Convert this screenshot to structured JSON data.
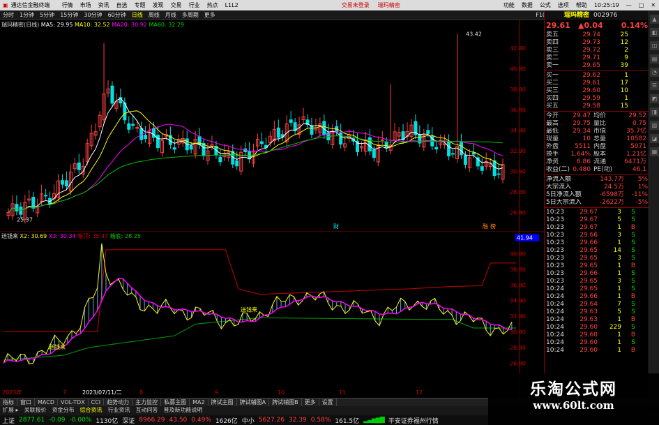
{
  "titlebar": {
    "app": "通达信金融终端",
    "menus": [
      "行情",
      "市场",
      "资讯",
      "自选",
      "专题",
      "发现",
      "交易",
      "行业",
      "热点",
      "L1L2"
    ],
    "center": [
      "交易未登录",
      "瑞玛精密"
    ],
    "right": [
      "功能",
      "数据",
      "公式",
      "选项",
      "帮助"
    ],
    "time": "10:25:19"
  },
  "toolbar": {
    "periods": [
      "分时",
      "1分钟",
      "5分钟",
      "15分钟",
      "30分钟",
      "60分钟",
      "日线",
      "周线",
      "月线",
      "多周期",
      "更多"
    ],
    "right": [
      "F10",
      "标记",
      "☰"
    ]
  },
  "chart_legend": {
    "name": "瑞玛精密(日线)",
    "ma5": "MA5: 29.95",
    "ma10": "MA10: 32.52",
    "ma20": "MA20: 30.92",
    "ma60": "MA60: 32.29"
  },
  "price_chart": {
    "high_label": "43.42",
    "low_label": "25.37",
    "axis": [
      "42.00",
      "40.00",
      "38.00",
      "36.00",
      "34.00",
      "32.00",
      "30.00",
      "28.00",
      "26.00"
    ],
    "markers": [
      "财",
      "融",
      "榜"
    ]
  },
  "indicator_legend": {
    "name": "送钱来",
    "x2": "X2: 30.69",
    "x3": "X3: 30.34",
    "box_top": "箱顶: 35.47",
    "box_bottom": "箱底: 28.25"
  },
  "indicator_chart": {
    "current": "41.94",
    "axis": [
      "40.00",
      "38.00",
      "36.00",
      "34.00",
      "32.00",
      "30.00",
      "28.00",
      "26.00"
    ],
    "label": "送钱来"
  },
  "time_axis": {
    "labels": [
      "2023年",
      "7",
      "2023/07/11/二",
      "8",
      "9",
      "10",
      "11",
      "12",
      "1"
    ]
  },
  "quote_header": {
    "name": "瑞玛精密",
    "code": "002976",
    "price": "29.61",
    "change": "▲0.04",
    "pct": "0.14%"
  },
  "order_book": {
    "asks": [
      {
        "label": "卖五",
        "price": "29.74",
        "vol": "25"
      },
      {
        "label": "卖四",
        "price": "29.73",
        "vol": "12"
      },
      {
        "label": "卖三",
        "price": "29.72",
        "vol": "2"
      },
      {
        "label": "卖二",
        "price": "29.71",
        "vol": "9"
      },
      {
        "label": "卖一",
        "price": "29.65",
        "vol": "39"
      }
    ],
    "bids": [
      {
        "label": "买一",
        "price": "29.62",
        "vol": "1"
      },
      {
        "label": "买二",
        "price": "29.61",
        "vol": "17"
      },
      {
        "label": "买三",
        "price": "29.60",
        "vol": "10"
      },
      {
        "label": "买四",
        "price": "29.59",
        "vol": "1"
      },
      {
        "label": "买五",
        "price": "29.58",
        "vol": "15"
      }
    ]
  },
  "stats": [
    {
      "a": "今开",
      "b": "29.47",
      "c": "均价",
      "d": "29.52"
    },
    {
      "a": "最高",
      "b": "29.75",
      "c": "量比",
      "d": "0.75"
    },
    {
      "a": "最低",
      "b": "29.34",
      "c": "市值",
      "d": "35.7亿"
    },
    {
      "a": "现量",
      "b": "10",
      "c": "总量",
      "d": "10582"
    },
    {
      "a": "外盘",
      "b": "5511",
      "c": "内盘",
      "d": "5071"
    },
    {
      "a": "换手",
      "b": "1.64%",
      "c": "股本",
      "d": "1.21亿"
    },
    {
      "a": "净资",
      "b": "6.86",
      "c": "流通",
      "d": "6471万"
    },
    {
      "a": "收益(二)",
      "b": "0.480",
      "c": "PE(动)",
      "d": "46.1"
    }
  ],
  "flows": [
    {
      "label": "净流入额",
      "value": "143.7万",
      "pct": "5%"
    },
    {
      "label": "大宗流入",
      "value": "24.5万",
      "pct": "1%"
    },
    {
      "label": "5日净流入额",
      "value": "-6598万",
      "pct": "-11%"
    },
    {
      "label": "5日大宗流入",
      "value": "-2622万",
      "pct": "-5%"
    }
  ],
  "ticks": [
    {
      "t": "10:23",
      "p": "29.67",
      "v": "3",
      "s": "S"
    },
    {
      "t": "10:23",
      "p": "29.67",
      "v": "5",
      "s": "S"
    },
    {
      "t": "10:23",
      "p": "29.67",
      "v": "1",
      "s": "B"
    },
    {
      "t": "10:23",
      "p": "29.66",
      "v": "3",
      "s": "S"
    },
    {
      "t": "10:23",
      "p": "29.66",
      "v": "1",
      "s": "S"
    },
    {
      "t": "10:23",
      "p": "29.65",
      "v": "14",
      "s": "S"
    },
    {
      "t": "10:23",
      "p": "29.65",
      "v": "3",
      "s": "S"
    },
    {
      "t": "10:23",
      "p": "29.65",
      "v": "1",
      "s": "B"
    },
    {
      "t": "10:23",
      "p": "29.66",
      "v": "1",
      "s": "S"
    },
    {
      "t": "10:23",
      "p": "29.65",
      "v": "3",
      "s": "S"
    },
    {
      "t": "10:24",
      "p": "29.65",
      "v": "1",
      "s": "S"
    },
    {
      "t": "10:24",
      "p": "29.66",
      "v": "1",
      "s": "B"
    },
    {
      "t": "10:24",
      "p": "29.64",
      "v": "7",
      "s": "S"
    },
    {
      "t": "10:24",
      "p": "29.63",
      "v": "5",
      "s": "S"
    },
    {
      "t": "10:24",
      "p": "29.63",
      "v": "1",
      "s": "B"
    },
    {
      "t": "10:24",
      "p": "29.60",
      "v": "229",
      "s": "S"
    },
    {
      "t": "10:24",
      "p": "29.60",
      "v": "1",
      "s": "B"
    },
    {
      "t": "10:24",
      "p": "29.60",
      "v": "1",
      "s": "S"
    },
    {
      "t": "10:24",
      "p": "29.60",
      "v": "1",
      "s": "B"
    }
  ],
  "bottom_tabs": [
    "指标",
    "窗口",
    "MACD",
    "VOL-TDX",
    "CCI",
    "趋势动力",
    "主力监控",
    "私募主图",
    "MA2",
    "牌试主图",
    "牌试辅图A",
    "牌试辅图B",
    "更多",
    "设置"
  ],
  "bottom_tabs2": [
    "扩展 ▸",
    "关联报价",
    "资金分布",
    "综合资讯",
    "行业资讯",
    "互动问答",
    "普及新功能说明"
  ],
  "status": {
    "idx1": {
      "name": "上证",
      "val": "2877.61",
      "chg": "-0.09",
      "pct": "-0.00%",
      "amt": "1130亿"
    },
    "idx2": {
      "name": "深证",
      "val": "8966.29",
      "chg": "43.50",
      "pct": "0.49%",
      "amt": "1626亿"
    },
    "idx3": {
      "name": "中小",
      "val": "5627.26",
      "chg": "32.39",
      "pct": "0.58%",
      "amt": "161.5亿"
    },
    "broker": "平安证券福州行情"
  },
  "watermark": {
    "line1": "乐淘公式网",
    "line2": "www.60lt.com"
  },
  "colors": {
    "up": "#ff4040",
    "down": "#00e0e0",
    "ma5": "#ffffff",
    "ma10": "#ffff00",
    "ma20": "#ff00ff",
    "ma60": "#00c000",
    "box": "#c80000"
  }
}
